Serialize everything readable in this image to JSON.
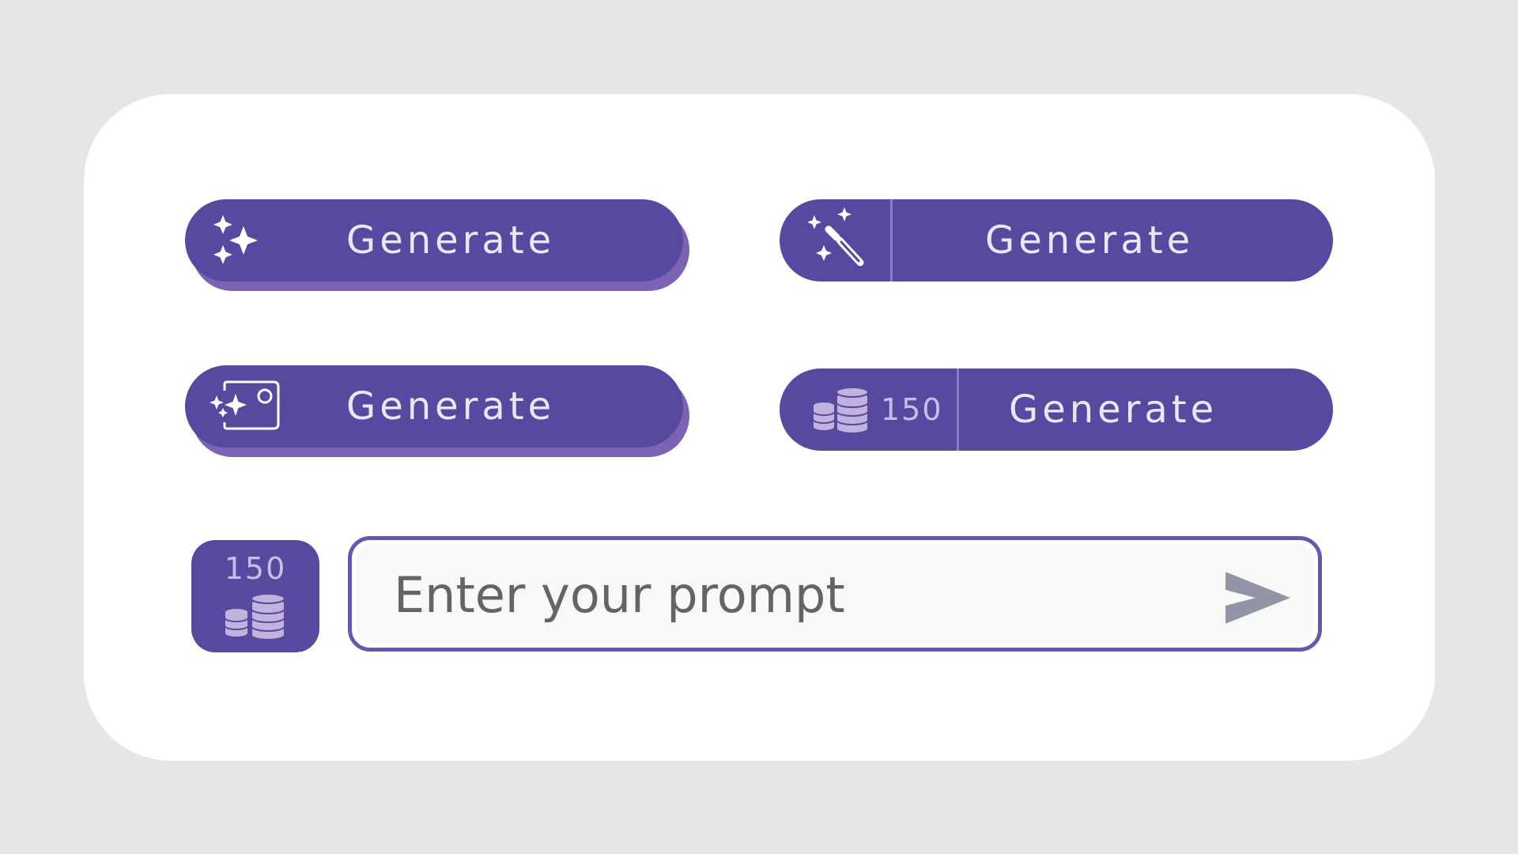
{
  "buttons": {
    "sparkles": {
      "label": "Generate",
      "icon": "sparkles-icon"
    },
    "magic_wand": {
      "label": "Generate",
      "icon": "magic-wand-icon"
    },
    "image_sparkles": {
      "label": "Generate",
      "icon": "image-sparkles-icon"
    },
    "coins": {
      "label": "Generate",
      "cost": "150",
      "icon": "coins-icon"
    }
  },
  "credits": {
    "count": "150",
    "icon": "coins-icon"
  },
  "prompt": {
    "placeholder": "Enter your prompt",
    "send_icon": "send-icon"
  },
  "colors": {
    "primary": "#5749a0",
    "shadow": "#7b63b3",
    "border": "#6a55ac",
    "coin": "#c2b2de",
    "send": "#9394a6",
    "background": "#e6e6e6"
  }
}
